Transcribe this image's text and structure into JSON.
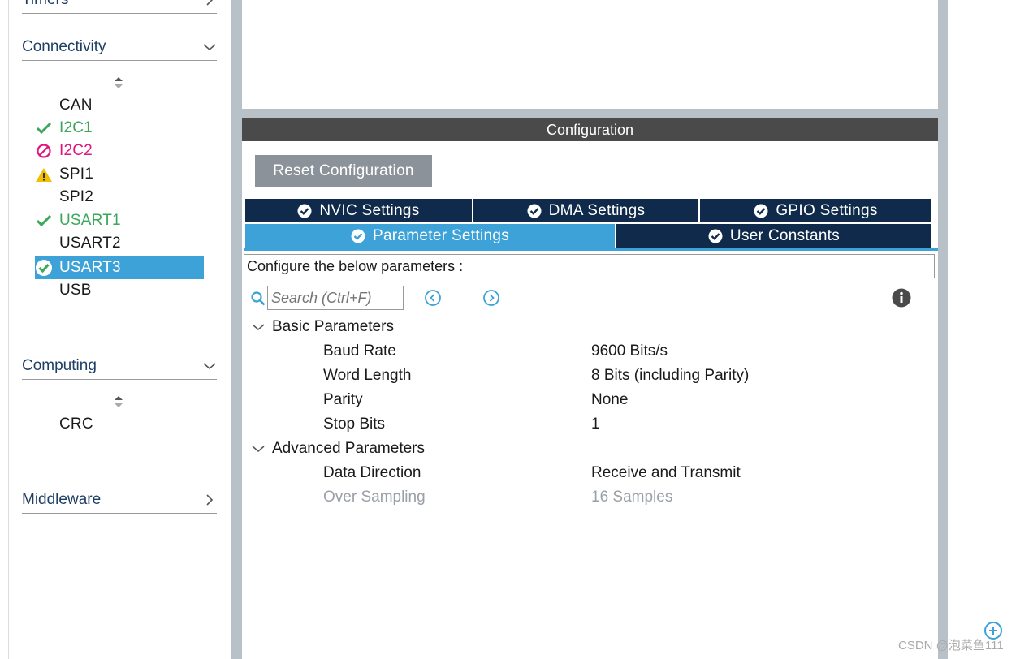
{
  "sidebar": {
    "timers_label": "Timers",
    "connectivity_label": "Connectivity",
    "connectivity_items": [
      {
        "label": "CAN",
        "status": "none"
      },
      {
        "label": "I2C1",
        "status": "ok"
      },
      {
        "label": "I2C2",
        "status": "error"
      },
      {
        "label": "SPI1",
        "status": "warning"
      },
      {
        "label": "SPI2",
        "status": "none"
      },
      {
        "label": "USART1",
        "status": "ok"
      },
      {
        "label": "USART2",
        "status": "none"
      },
      {
        "label": "USART3",
        "status": "selected-ok"
      },
      {
        "label": "USB",
        "status": "none"
      }
    ],
    "computing_label": "Computing",
    "computing_items": [
      {
        "label": "CRC",
        "status": "none"
      }
    ],
    "middleware_label": "Middleware"
  },
  "config": {
    "title": "Configuration",
    "reset_label": "Reset Configuration",
    "tabs": {
      "nvic": "NVIC Settings",
      "dma": "DMA Settings",
      "gpio": "GPIO Settings",
      "parameter": "Parameter Settings",
      "user_constants": "User Constants"
    },
    "active_tab": "Parameter Settings",
    "hint": "Configure the below parameters :",
    "search_placeholder": "Search (Ctrl+F)",
    "groups": [
      {
        "name": "Basic Parameters",
        "params": [
          {
            "name": "Baud Rate",
            "value": "9600 Bits/s"
          },
          {
            "name": "Word Length",
            "value": "8 Bits (including Parity)"
          },
          {
            "name": "Parity",
            "value": "None"
          },
          {
            "name": "Stop Bits",
            "value": "1"
          }
        ]
      },
      {
        "name": "Advanced Parameters",
        "params": [
          {
            "name": "Data Direction",
            "value": "Receive and Transmit"
          },
          {
            "name": "Over Sampling",
            "value": "16 Samples",
            "disabled": true
          }
        ]
      }
    ]
  },
  "watermark": "CSDN @泡菜鱼111",
  "colors": {
    "accent": "#3ca2d8",
    "tab_dark": "#0f2a4a",
    "ok": "#3aa75a",
    "error": "#e0157e",
    "warning": "#f0c000",
    "header_bar": "#4a4a4a",
    "button_gray": "#8c9299"
  },
  "icons": {
    "ok": "check-icon",
    "error": "prohibited-icon",
    "warning": "warning-icon",
    "selected": "check-circle-icon",
    "search": "search-icon",
    "prev": "prev-circle-icon",
    "next": "next-circle-icon",
    "info": "info-icon",
    "zoom": "zoom-in-icon"
  }
}
